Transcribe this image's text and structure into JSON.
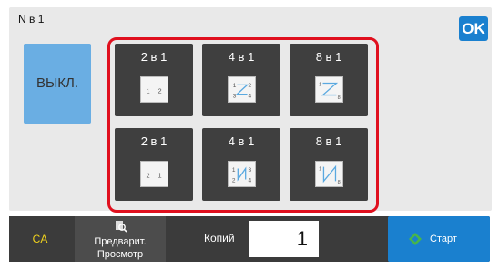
{
  "header": {
    "title": "N в 1",
    "ok_label": "OK"
  },
  "off_button": {
    "label": "ВЫКЛ."
  },
  "layouts": {
    "top_row": [
      {
        "label": "2 в 1",
        "glyphs": [
          "1",
          "2"
        ],
        "icon": "two-page-ltr-icon"
      },
      {
        "label": "4 в 1",
        "glyphs": [
          "1",
          "2",
          "3",
          "4"
        ],
        "icon": "four-page-z-icon"
      },
      {
        "label": "8 в 1",
        "glyphs": [
          "1",
          "8"
        ],
        "icon": "eight-page-z-icon"
      }
    ],
    "bottom_row": [
      {
        "label": "2 в 1",
        "glyphs": [
          "2",
          "1"
        ],
        "icon": "two-page-rtl-icon"
      },
      {
        "label": "4 в 1",
        "glyphs": [
          "1",
          "3",
          "2",
          "4"
        ],
        "icon": "four-page-n-icon"
      },
      {
        "label": "8 в 1",
        "glyphs": [
          "1",
          "8"
        ],
        "icon": "eight-page-n-icon"
      }
    ]
  },
  "footer": {
    "ca_label": "CA",
    "preview_line1": "Предварит.",
    "preview_line2": "Просмотр",
    "copies_label": "Копий",
    "copies_value": "1",
    "start_label": "Старт"
  },
  "colors": {
    "accent_blue": "#1a80cf",
    "off_button_blue": "#6aaee3",
    "selection_frame_red": "#e0101e",
    "tile_dark": "#3f3f3f",
    "ca_yellow": "#f0d21d",
    "start_icon_green": "#47b54a"
  }
}
